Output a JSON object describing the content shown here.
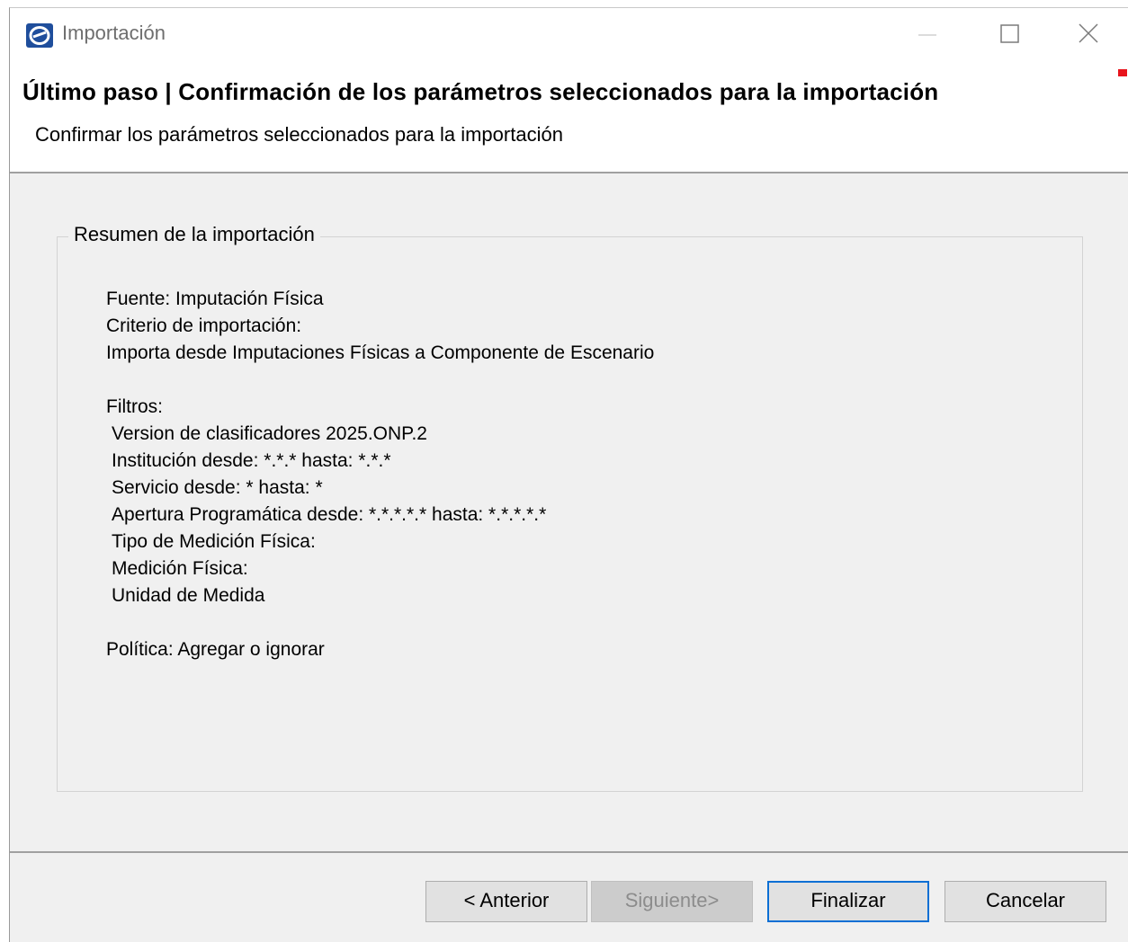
{
  "window": {
    "title": "Importación",
    "icon": "app-logo-icon",
    "controls": [
      "minimize-icon",
      "maximize-icon",
      "close-icon"
    ]
  },
  "header": {
    "title": "Último paso | Confirmación de los parámetros seleccionados para la importación",
    "subtitle": "Confirmar los parámetros seleccionados para la importación"
  },
  "summary": {
    "legend": "Resumen de la importación",
    "source": "Fuente: Imputación Física",
    "criterion_label": "Criterio de importación:",
    "criterion_value": "Importa desde Imputaciones Físicas a Componente de Escenario",
    "filters_label": "Filtros:",
    "filters": [
      "Version de clasificadores 2025.ONP.2",
      "Institución desde: *.*.* hasta: *.*.*",
      "Servicio desde: * hasta: *",
      "Apertura Programática desde: *.*.*.*.* hasta: *.*.*.*.*",
      "Tipo de Medición Física:",
      "Medición Física:",
      "Unidad de Medida"
    ],
    "policy": "Política: Agregar o ignorar"
  },
  "buttons": {
    "previous": "< Anterior",
    "next": "Siguiente>",
    "finish": "Finalizar",
    "cancel": "Cancelar"
  },
  "colors": {
    "dialog_bg": "#f0f0f0",
    "focus_border": "#0a6fd4",
    "app_icon": "#1f4e9c"
  }
}
